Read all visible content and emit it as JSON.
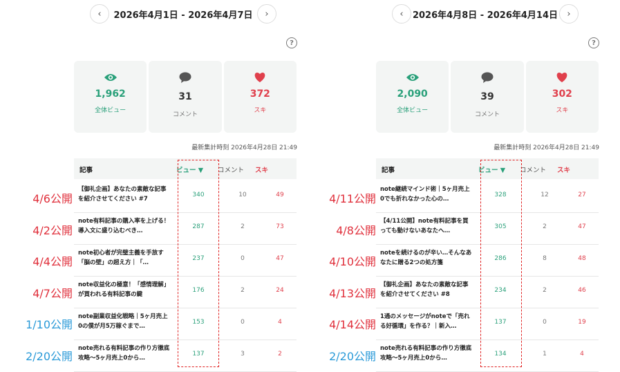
{
  "left": {
    "date_range": "2026年4月1日 - 2026年4月7日",
    "prev_glyph": "‹",
    "next_glyph": "›",
    "help_glyph": "?",
    "stats": {
      "views": {
        "value": "1,962",
        "label": "全体ビュー",
        "icon": "eye-icon"
      },
      "comments": {
        "value": "31",
        "label": "コメント",
        "icon": "speech-bubble-icon"
      },
      "likes": {
        "value": "372",
        "label": "スキ",
        "icon": "heart-icon"
      }
    },
    "updated": "最新集計時刻 2026年4月28日 21:49",
    "headers": {
      "article": "記事",
      "views": "ビュー ▼",
      "comments": "コメント",
      "likes": "スキ"
    },
    "rows": [
      {
        "title": "【御礼企画】あなたの素敵な記事を紹介させてください #7",
        "views": "340",
        "comments": "10",
        "likes": "49",
        "published": "4/6公開",
        "color": "#e0303c"
      },
      {
        "title": "note有料記事の購入率を上げる！導入文に盛り込むべき…",
        "views": "287",
        "comments": "2",
        "likes": "73",
        "published": "4/2公開",
        "color": "#e0303c"
      },
      {
        "title": "note初心者が完璧主義を手放す「脳の壁」の超え方｜「…",
        "views": "237",
        "comments": "0",
        "likes": "47",
        "published": "4/4公開",
        "color": "#e0303c"
      },
      {
        "title": "note収益化の極意！「感情理解」が買われる有料記事の鍵",
        "views": "176",
        "comments": "2",
        "likes": "24",
        "published": "4/7公開",
        "color": "#e0303c"
      },
      {
        "title": "note副業収益化戦略｜5ヶ月売上0の僕が月5万稼ぐまで…",
        "views": "153",
        "comments": "0",
        "likes": "4",
        "published": "1/10公開",
        "color": "#2a9ad8"
      },
      {
        "title": "note売れる有料記事の作り方徹底攻略〜5ヶ月売上0から…",
        "views": "137",
        "comments": "3",
        "likes": "2",
        "published": "2/20公開",
        "color": "#2a9ad8"
      }
    ]
  },
  "right": {
    "date_range": "2026年4月8日 - 2026年4月14日",
    "prev_glyph": "‹",
    "next_glyph": "›",
    "help_glyph": "?",
    "stats": {
      "views": {
        "value": "2,090",
        "label": "全体ビュー",
        "icon": "eye-icon"
      },
      "comments": {
        "value": "39",
        "label": "コメント",
        "icon": "speech-bubble-icon"
      },
      "likes": {
        "value": "302",
        "label": "スキ",
        "icon": "heart-icon"
      }
    },
    "updated": "最新集計時刻 2026年4月28日 21:49",
    "headers": {
      "article": "記事",
      "views": "ビュー ▼",
      "comments": "コメント",
      "likes": "スキ"
    },
    "rows": [
      {
        "title": "note継続マインド術｜5ヶ月売上0でも折れなかった心の…",
        "views": "328",
        "comments": "12",
        "likes": "27",
        "published": "4/11公開",
        "color": "#e0303c"
      },
      {
        "title": "【4/11公開】note有料記事を買っても動けないあなたへ…",
        "views": "305",
        "comments": "2",
        "likes": "47",
        "published": "4/8公開",
        "color": "#e0303c"
      },
      {
        "title": "noteを続けるのが辛い…そんなあなたに贈る2つの処方箋",
        "views": "286",
        "comments": "8",
        "likes": "48",
        "published": "4/10公開",
        "color": "#e0303c"
      },
      {
        "title": "【御礼企画】あなたの素敵な記事を紹介させてください #8",
        "views": "234",
        "comments": "2",
        "likes": "46",
        "published": "4/13公開",
        "color": "#e0303c"
      },
      {
        "title": "1通のメッセージがnoteで「売れる好循環」を作る？｜新入…",
        "views": "137",
        "comments": "0",
        "likes": "19",
        "published": "4/14公開",
        "color": "#e0303c"
      },
      {
        "title": "note売れる有料記事の作り方徹底攻略〜5ヶ月売上0から…",
        "views": "134",
        "comments": "1",
        "likes": "4",
        "published": "2/20公開",
        "color": "#2a9ad8"
      }
    ]
  },
  "colors": {
    "accent_green": "#2aa07a",
    "like_red": "#e0404c",
    "annotation_red": "#e0303c",
    "annotation_blue": "#2a9ad8"
  }
}
